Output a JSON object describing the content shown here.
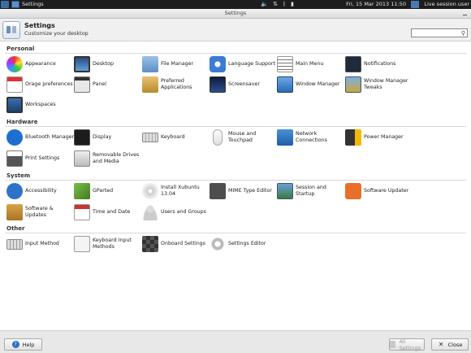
{
  "panel": {
    "task_title": "Settings",
    "clock": "Fri, 15 Mar 2013 11:50",
    "session": "Live session user"
  },
  "window": {
    "title": "Settings"
  },
  "header": {
    "title": "Settings",
    "subtitle": "Customize your desktop",
    "search_placeholder": ""
  },
  "sections": {
    "personal": {
      "title": "Personal",
      "items": [
        {
          "label": "Appearance"
        },
        {
          "label": "Desktop"
        },
        {
          "label": "File Manager"
        },
        {
          "label": "Language Support"
        },
        {
          "label": "Main Menu"
        },
        {
          "label": "Notifications"
        },
        {
          "label": "Orage preferences"
        },
        {
          "label": "Panel"
        },
        {
          "label": "Preferred Applications"
        },
        {
          "label": "Screensaver"
        },
        {
          "label": "Window Manager"
        },
        {
          "label": "Window Manager Tweaks"
        },
        {
          "label": "Workspaces"
        }
      ]
    },
    "hardware": {
      "title": "Hardware",
      "items": [
        {
          "label": "Bluetooth Manager"
        },
        {
          "label": "Display"
        },
        {
          "label": "Keyboard"
        },
        {
          "label": "Mouse and Touchpad"
        },
        {
          "label": "Network Connections"
        },
        {
          "label": "Power Manager"
        },
        {
          "label": "Print Settings"
        },
        {
          "label": "Removable Drives and Media"
        }
      ]
    },
    "system": {
      "title": "System",
      "items": [
        {
          "label": "Accessibility"
        },
        {
          "label": "GParted"
        },
        {
          "label": "Install Xubuntu 13.04"
        },
        {
          "label": "MIME Type Editor"
        },
        {
          "label": "Session and Startup"
        },
        {
          "label": "Software Updater"
        },
        {
          "label": "Software & Updates"
        },
        {
          "label": "Time and Date"
        },
        {
          "label": "Users and Groups"
        }
      ]
    },
    "other": {
      "title": "Other",
      "items": [
        {
          "label": "Input Method"
        },
        {
          "label": "Keyboard Input Methods"
        },
        {
          "label": "Onboard Settings"
        },
        {
          "label": "Settings Editor"
        }
      ]
    }
  },
  "footer": {
    "help_label": "Help",
    "all_settings_label": "All Settings",
    "close_label": "Close"
  },
  "icons": {
    "help": "help-icon",
    "close": "close-icon",
    "search": "search-icon"
  }
}
